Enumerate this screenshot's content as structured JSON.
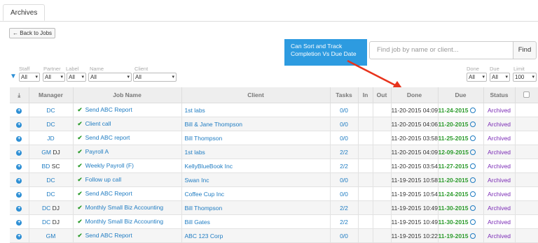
{
  "tabs": [
    {
      "label": "Archives"
    }
  ],
  "back_button": {
    "label": "Back to Jobs"
  },
  "callout": {
    "line1": "Can Sort and Track",
    "line2": "Completion Vs Due Date"
  },
  "search": {
    "placeholder": "Find job by name or client...",
    "button": "Find"
  },
  "filters": {
    "staff": {
      "label": "Staff",
      "value": "All"
    },
    "partner": {
      "label": "Partner",
      "value": "All"
    },
    "labelf": {
      "label": "Label",
      "value": "All"
    },
    "name": {
      "label": "Name",
      "value": "All"
    },
    "client": {
      "label": "Client",
      "value": "All"
    },
    "done": {
      "label": "Done",
      "value": "All"
    },
    "due": {
      "label": "Due",
      "value": "All"
    },
    "limit": {
      "label": "Limit",
      "value": "100"
    }
  },
  "columns": [
    "Manager",
    "Job Name",
    "Client",
    "Tasks",
    "In",
    "Out",
    "Done",
    "Due",
    "Status"
  ],
  "rows": [
    {
      "mgr": "DC",
      "mgr2": "",
      "job": "Send ABC Report",
      "client": "1st labs",
      "tasks": "0/0",
      "done": "11-20-2015 04:09 PM",
      "due": "11-24-2015",
      "status": "Archived"
    },
    {
      "mgr": "DC",
      "mgr2": "",
      "job": "Client call",
      "client": "Bill & Jane Thompson",
      "tasks": "0/0",
      "done": "11-20-2015 04:06 PM",
      "due": "11-20-2015",
      "status": "Archived"
    },
    {
      "mgr": "JD",
      "mgr2": "",
      "job": "Send ABC report",
      "client": "Bill Thompson",
      "tasks": "0/0",
      "done": "11-20-2015 03:58 PM",
      "due": "11-25-2015",
      "status": "Archived"
    },
    {
      "mgr": "GM",
      "mgr2": "DJ",
      "job": "Payroll A",
      "client": "1st labs",
      "tasks": "2/2",
      "done": "11-20-2015 04:09 PM",
      "due": "12-09-2015",
      "status": "Archived"
    },
    {
      "mgr": "BD",
      "mgr2": "SC",
      "job": "Weekly Payroll (F)",
      "client": "KellyBlueBook Inc",
      "tasks": "2/2",
      "done": "11-20-2015 03:54 PM",
      "due": "11-27-2015",
      "status": "Archived"
    },
    {
      "mgr": "DC",
      "mgr2": "",
      "job": "Follow up call",
      "client": "Swan Inc",
      "tasks": "0/0",
      "done": "11-19-2015 10:58 AM",
      "due": "11-20-2015",
      "status": "Archived"
    },
    {
      "mgr": "DC",
      "mgr2": "",
      "job": "Send ABC Report",
      "client": "Coffee Cup Inc",
      "tasks": "0/0",
      "done": "11-19-2015 10:54 AM",
      "due": "11-24-2015",
      "status": "Archived"
    },
    {
      "mgr": "DC",
      "mgr2": "DJ",
      "job": "Monthly Small Biz Accounting",
      "client": "Bill Thompson",
      "tasks": "2/2",
      "done": "11-19-2015 10:49 AM",
      "due": "11-30-2015",
      "status": "Archived"
    },
    {
      "mgr": "DC",
      "mgr2": "DJ",
      "job": "Monthly Small Biz Accounting",
      "client": "Bill Gates",
      "tasks": "2/2",
      "done": "11-19-2015 10:49 AM",
      "due": "11-30-2015",
      "status": "Archived"
    },
    {
      "mgr": "GM",
      "mgr2": "",
      "job": "Send ABC Report",
      "client": "ABC 123 Corp",
      "tasks": "0/0",
      "done": "11-19-2015 10:22 AM",
      "due": "11-19-2015",
      "status": "Archived"
    }
  ],
  "colors": {
    "accent": "#2d9be0",
    "link": "#1f7cc2",
    "due_green": "#2a9a2a",
    "archived": "#7a2ab5",
    "arrow": "#e8331c"
  }
}
